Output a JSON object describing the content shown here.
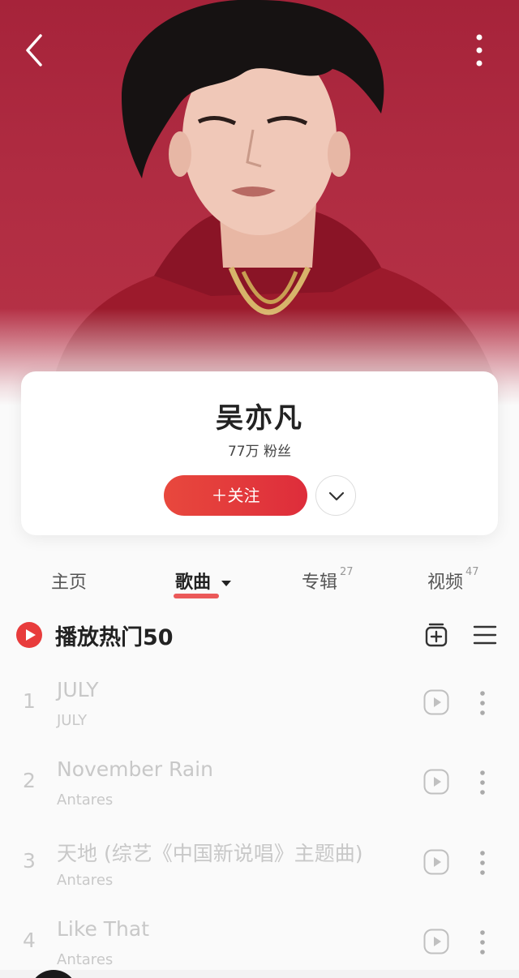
{
  "header": {
    "back_icon": "chevron-left-icon",
    "more_icon": "vertical-dots-icon",
    "hero_image": "artist-portrait-photo"
  },
  "artist": {
    "name": "吴亦凡",
    "fans": "77万 粉丝",
    "follow_label": "＋关注",
    "expand_icon": "chevron-down-icon"
  },
  "tabs": [
    {
      "label": "主页",
      "count": ""
    },
    {
      "label": "歌曲",
      "count": ""
    },
    {
      "label": "专辑",
      "count": "27"
    },
    {
      "label": "视频",
      "count": "47"
    }
  ],
  "active_tab": "歌曲",
  "playall": {
    "title": "播放热门50",
    "icons": [
      "play-circle-icon",
      "add-to-collection-icon",
      "list-menu-icon"
    ]
  },
  "songs": [
    {
      "index": "1",
      "title": "JULY",
      "subtitle": "JULY"
    },
    {
      "index": "2",
      "title": "November Rain",
      "subtitle": "Antares"
    },
    {
      "index": "3",
      "title": "天地 (综艺《中国新说唱》主题曲)",
      "subtitle": "Antares"
    },
    {
      "index": "4",
      "title": "Like That",
      "subtitle": "Antares"
    }
  ],
  "colors": {
    "accent": "#e83c3c",
    "hero": "#b02c42",
    "disabled_text": "#c8c8c8"
  }
}
